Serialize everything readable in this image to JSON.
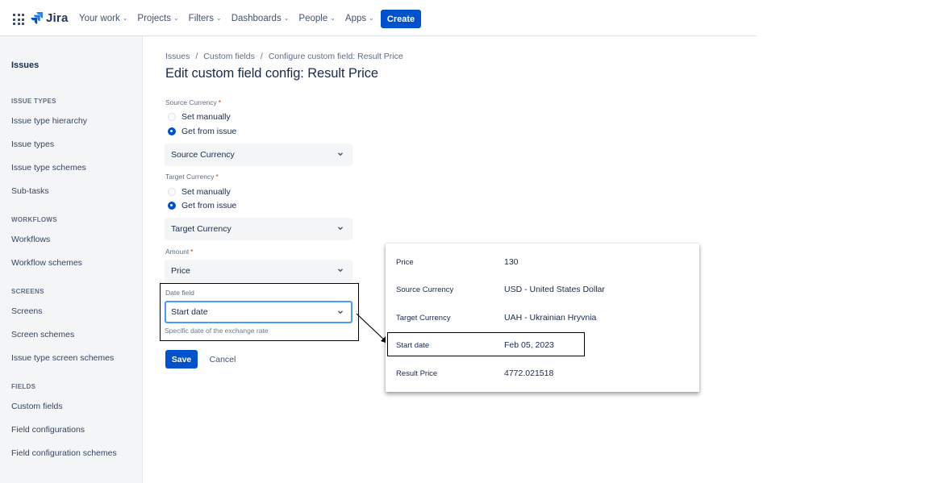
{
  "nav": {
    "logo_text": "Jira",
    "items": [
      {
        "label": "Your work"
      },
      {
        "label": "Projects"
      },
      {
        "label": "Filters"
      },
      {
        "label": "Dashboards"
      },
      {
        "label": "People"
      },
      {
        "label": "Apps"
      }
    ],
    "create_label": "Create"
  },
  "sidebar": {
    "title": "Issues",
    "sections": [
      {
        "label": "ISSUE TYPES",
        "items": [
          "Issue type hierarchy",
          "Issue types",
          "Issue type schemes",
          "Sub-tasks"
        ]
      },
      {
        "label": "WORKFLOWS",
        "items": [
          "Workflows",
          "Workflow schemes"
        ]
      },
      {
        "label": "SCREENS",
        "items": [
          "Screens",
          "Screen schemes",
          "Issue type screen schemes"
        ]
      },
      {
        "label": "FIELDS",
        "items": [
          "Custom fields",
          "Field configurations",
          "Field configuration schemes"
        ]
      }
    ]
  },
  "breadcrumb": [
    "Issues",
    "Custom fields",
    "Configure custom field: Result Price"
  ],
  "page_title": "Edit custom field config: Result Price",
  "form": {
    "source_currency": {
      "label": "Source Currency",
      "option_manual": "Set manually",
      "option_issue": "Get from issue",
      "selected": "Get from issue",
      "select_value": "Source Currency"
    },
    "target_currency": {
      "label": "Target Currency",
      "option_manual": "Set manually",
      "option_issue": "Get from issue",
      "selected": "Get from issue",
      "select_value": "Target Currency"
    },
    "amount": {
      "label": "Amount",
      "select_value": "Price"
    },
    "date_field": {
      "label": "Date field",
      "select_value": "Start date",
      "helper": "Specific date of the exchange rate"
    },
    "required_mark": "*",
    "save_label": "Save",
    "cancel_label": "Cancel"
  },
  "result_panel": {
    "rows": [
      {
        "label": "Price",
        "value": "130"
      },
      {
        "label": "Source Currency",
        "value": "USD - United States Dollar"
      },
      {
        "label": "Target Currency",
        "value": "UAH - Ukrainian Hryvnia"
      },
      {
        "label": "Start date",
        "value": "Feb 05, 2023"
      },
      {
        "label": "Result Price",
        "value": "4772.021518"
      }
    ]
  },
  "colors": {
    "accent": "#0052cc",
    "required": "#de350b",
    "focus": "#4c9aff"
  }
}
